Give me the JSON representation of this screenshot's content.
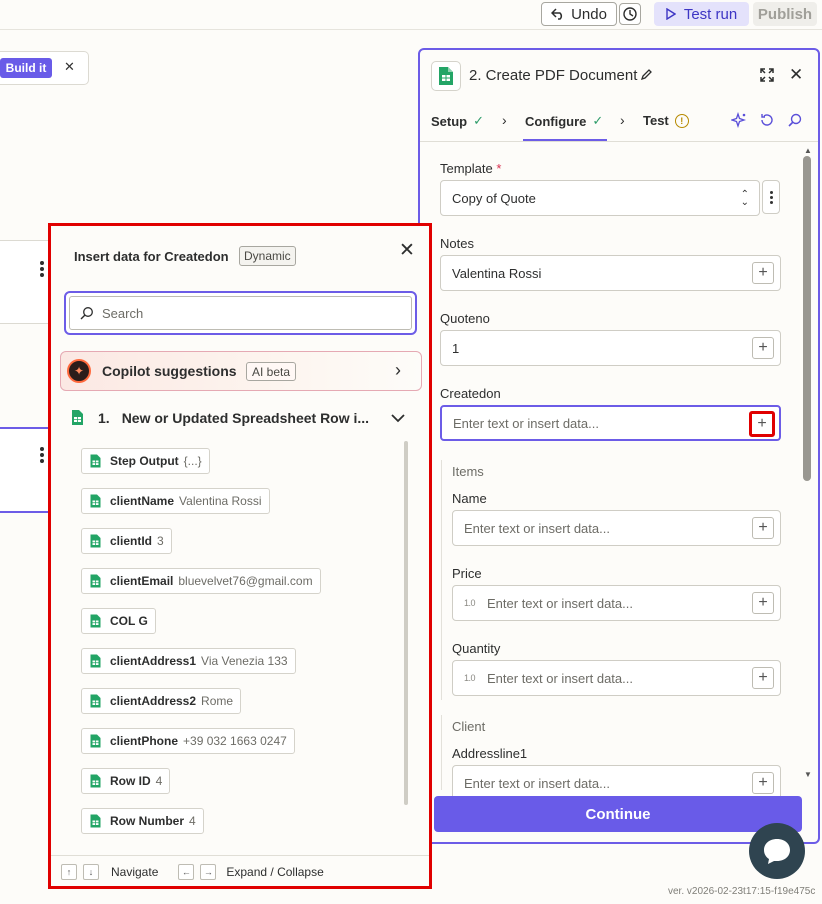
{
  "toolbar": {
    "undo_label": "Undo",
    "test_run_label": "Test run",
    "publish_label": "Publish"
  },
  "canvas": {
    "build_it_label": "Build it",
    "version_text": "ver. v2026-02-23t17:15-f19e475c"
  },
  "panel": {
    "title": "2. Create PDF Document",
    "tabs": [
      {
        "label": "Setup",
        "status": "check"
      },
      {
        "label": "Configure",
        "status": "check"
      },
      {
        "label": "Test",
        "status": "warning"
      }
    ],
    "fields": {
      "template": {
        "label": "Template",
        "required_mark": "*",
        "value": "Copy of Quote"
      },
      "notes": {
        "label": "Notes",
        "value": "Valentina Rossi"
      },
      "quoteno": {
        "label": "Quoteno",
        "value": "1"
      },
      "createdon": {
        "label": "Createdon",
        "placeholder": "Enter text or insert data..."
      }
    },
    "items_group": {
      "title": "Items",
      "name": {
        "label": "Name",
        "placeholder": "Enter text or insert data..."
      },
      "price": {
        "label": "Price",
        "badge": "1.0",
        "placeholder": "Enter text or insert data..."
      },
      "quantity": {
        "label": "Quantity",
        "badge": "1.0",
        "placeholder": "Enter text or insert data..."
      }
    },
    "client_group": {
      "title": "Client",
      "addressline1": {
        "label": "Addressline1",
        "placeholder": "Enter text or insert data..."
      }
    },
    "continue_label": "Continue",
    "accent_color": "#695be8"
  },
  "insert_popup": {
    "title": "Insert data for Createdon",
    "mode_chip": "Dynamic",
    "search_placeholder": "Search",
    "copilot": {
      "label": "Copilot suggestions",
      "chip": "AI beta"
    },
    "source": {
      "number": "1.",
      "name": "New or Updated Spreadsheet Row i..."
    },
    "items": [
      {
        "key": "Step Output",
        "value": "{...}"
      },
      {
        "key": "clientName",
        "value": "Valentina Rossi"
      },
      {
        "key": "clientId",
        "value": "3"
      },
      {
        "key": "clientEmail",
        "value": "bluevelvet76@gmail.com"
      },
      {
        "key": "COL G",
        "value": ""
      },
      {
        "key": "clientAddress1",
        "value": "Via Venezia 133"
      },
      {
        "key": "clientAddress2",
        "value": "Rome"
      },
      {
        "key": "clientPhone",
        "value": "+39 032 1663 0247"
      },
      {
        "key": "Row ID",
        "value": "4"
      },
      {
        "key": "Row Number",
        "value": "4"
      }
    ],
    "footer": {
      "navigate_label": "Navigate",
      "expand_label": "Expand / Collapse"
    },
    "highlight_color": "#e00000"
  }
}
